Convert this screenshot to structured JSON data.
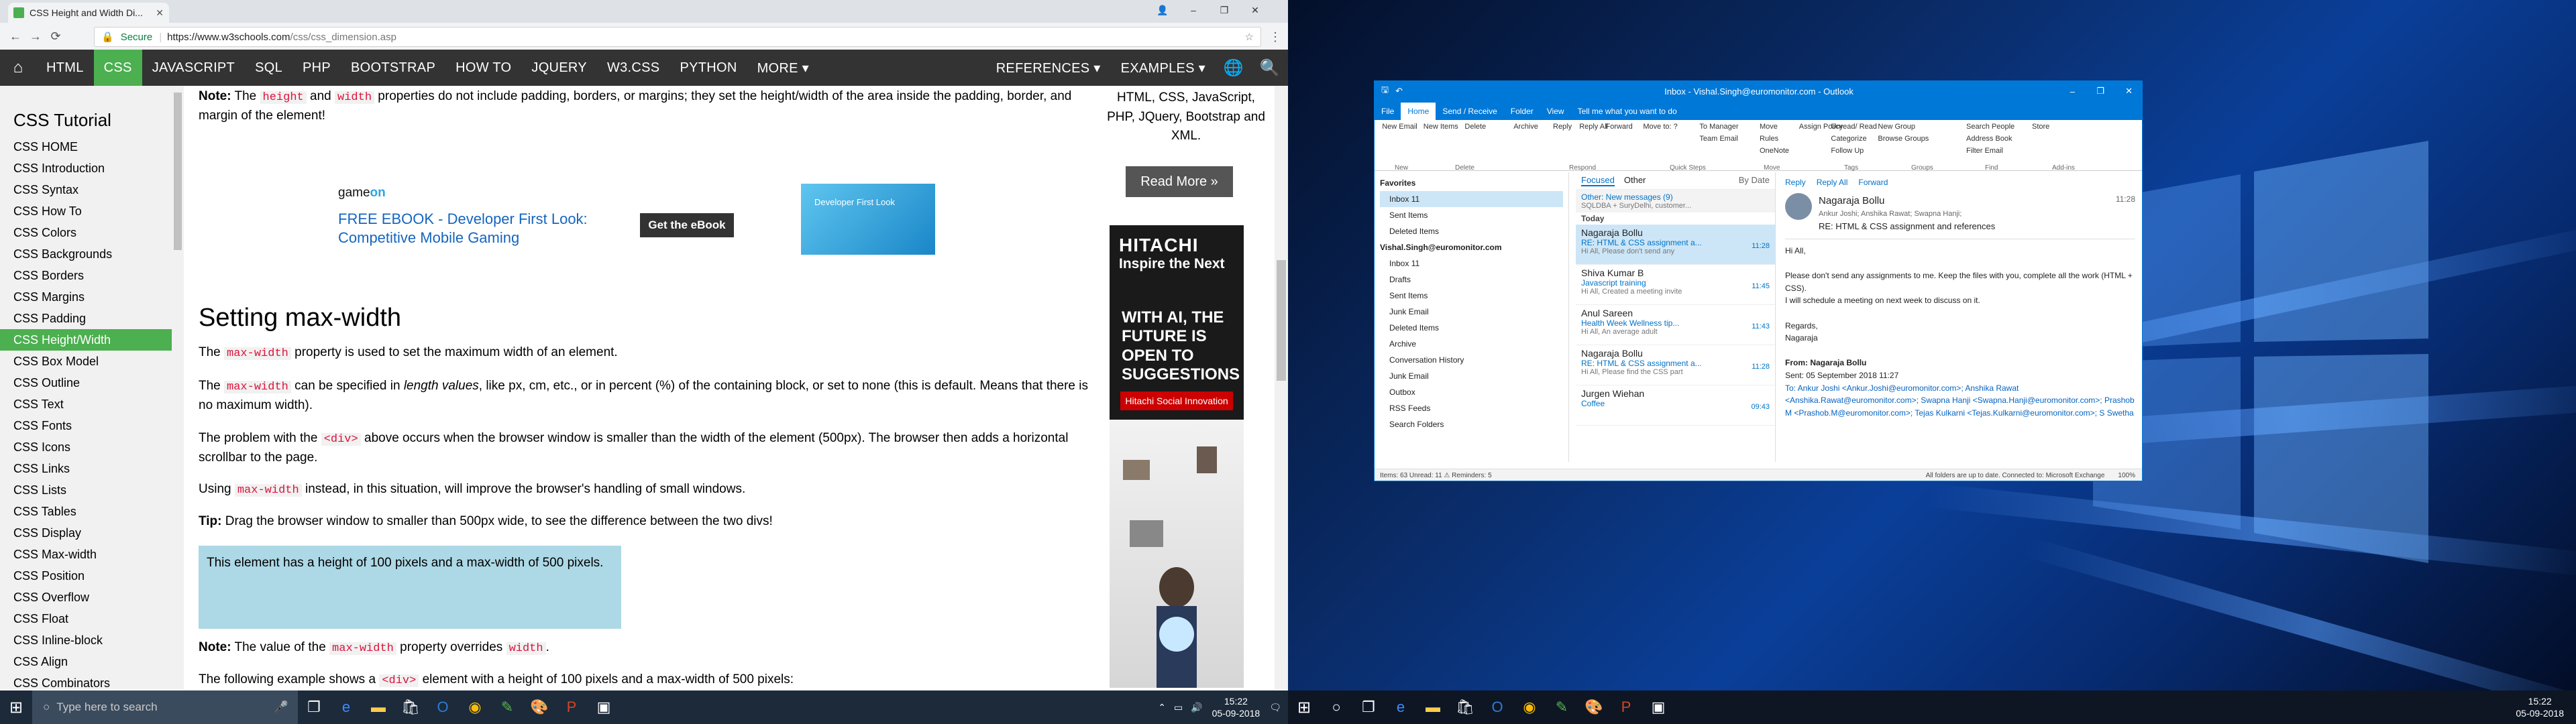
{
  "browser": {
    "tab_title": "CSS Height and Width Di...",
    "secure": "Secure",
    "url_host": "https://www.w3schools.com",
    "url_path": "/css/css_dimension.asp"
  },
  "nav": {
    "items": [
      "HTML",
      "CSS",
      "JAVASCRIPT",
      "SQL",
      "PHP",
      "BOOTSTRAP",
      "HOW TO",
      "JQUERY",
      "W3.CSS",
      "PYTHON",
      "MORE ▾",
      "REFERENCES ▾",
      "EXAMPLES ▾"
    ]
  },
  "sidebar": {
    "title": "CSS Tutorial",
    "links": [
      "CSS HOME",
      "CSS Introduction",
      "CSS Syntax",
      "CSS How To",
      "CSS Colors",
      "CSS Backgrounds",
      "CSS Borders",
      "CSS Margins",
      "CSS Padding",
      "CSS Height/Width",
      "CSS Box Model",
      "CSS Outline",
      "CSS Text",
      "CSS Fonts",
      "CSS Icons",
      "CSS Links",
      "CSS Lists",
      "CSS Tables",
      "CSS Display",
      "CSS Max-width",
      "CSS Position",
      "CSS Overflow",
      "CSS Float",
      "CSS Inline-block",
      "CSS Align",
      "CSS Combinators"
    ]
  },
  "main": {
    "note_pre": "Note:",
    "note_text1": " The ",
    "note_code1": "height",
    "note_and": " and ",
    "note_code2": "width",
    "note_text2": " properties do not include padding, borders, or margins; they set the height/width of the area inside the padding, border, and margin of the element!",
    "ad_logo_a": "game",
    "ad_logo_b": "on",
    "ad_line1": "FREE EBOOK - Developer First Look:",
    "ad_line2": "Competitive Mobile Gaming",
    "ad_button": "Get the eBook",
    "ad_book": "Developer First Look",
    "heading": "Setting max-width",
    "p1_a": "The ",
    "p1_code": "max-width",
    "p1_b": " property is used to set the maximum width of an element.",
    "p2_a": "The ",
    "p2_code": "max-width",
    "p2_b": " can be specified in ",
    "p2_i": "length values",
    "p2_c": ", like px, cm, etc., or in percent (%) of the containing block, or set to none (this is default. Means that there is no maximum width).",
    "p3_a": "The problem with the ",
    "p3_code": "<div>",
    "p3_b": " above occurs when the browser window is smaller than the width of the element (500px). The browser then adds a horizontal scrollbar to the page.",
    "p4_a": "Using ",
    "p4_code": "max-width",
    "p4_b": " instead, in this situation, will improve the browser's handling of small windows.",
    "tip_b": "Tip:",
    "tip_t": " Drag the browser window to smaller than 500px wide, to see the difference between the two divs!",
    "demo": "This element has a height of 100 pixels and a max-width of 500 pixels.",
    "note2_b": "Note:",
    "note2_a": " The value of the ",
    "note2_code1": "max-width",
    "note2_c": " property overrides ",
    "note2_code2": "width",
    "note2_d": ".",
    "last_a": "The following example shows a ",
    "last_code": "<div>",
    "last_b": " element with a height of 100 pixels and a max-width of 500 pixels:"
  },
  "right": {
    "text": "HTML, CSS, JavaScript, PHP, JQuery, Bootstrap and XML.",
    "read_more": "Read More »",
    "hitachi_brand": "HITACHI",
    "hitachi_tag": "Inspire the Next",
    "hitachi_big": "WITH AI, THE FUTURE IS OPEN TO SUGGESTIONS",
    "hitachi_pill": "Hitachi Social Innovation"
  },
  "taskbar1": {
    "search": "Type here to search",
    "time": "15:22",
    "date": "05-09-2018"
  },
  "taskbar2": {
    "time": "15:22",
    "date": "05-09-2018"
  },
  "outlook": {
    "title": "Inbox - Vishal.Singh@euromonitor.com - Outlook",
    "menu": [
      "File",
      "Home",
      "Send / Receive",
      "Folder",
      "View",
      "Tell me what you want to do"
    ],
    "ribbon": [
      "New Email",
      "New Items",
      "Delete",
      "Archive",
      "Reply",
      "Reply All",
      "Forward",
      "Move to: ?",
      "To Manager",
      "Team Email",
      "Move",
      "Rules",
      "OneNote",
      "Assign Policy",
      "Unread/ Read",
      "Categorize",
      "Follow Up",
      "New Group",
      "Browse Groups",
      "Search People",
      "Address Book",
      "Filter Email",
      "Store"
    ],
    "groups": [
      "New",
      "Delete",
      "Respond",
      "Quick Steps",
      "Move",
      "Tags",
      "Groups",
      "Find",
      "Add-ins"
    ],
    "folders": [
      "Favorites",
      "Inbox 11",
      "Sent Items",
      "Deleted Items",
      "Vishal.Singh@euromonitor.com",
      "Inbox 11",
      "Drafts",
      "Sent Items",
      "Junk Email",
      "Deleted Items",
      "Archive",
      "Conversation History",
      "Junk Email",
      "Outbox",
      "RSS Feeds",
      "Search Folders"
    ],
    "list_head": [
      "Focused",
      "Other",
      "By Date"
    ],
    "other": "Other: New messages (9)",
    "other_sub": "SQLDBA + SuryDelhi, customer...",
    "today": "Today",
    "mails": [
      {
        "name": "Nagaraja Bollu",
        "subj": "RE: HTML & CSS assignment a...",
        "prev": "Hi All,  Please don't send any",
        "time": "11:28"
      },
      {
        "name": "Shiva Kumar B",
        "subj": "Javascript training",
        "prev": "Hi All,  Created a meeting invite",
        "time": "11:45"
      },
      {
        "name": "Anul Sareen",
        "subj": "Health Week  Wellness tip...",
        "prev": "Hi All,  An average adult",
        "time": "11:43"
      },
      {
        "name": "Nagaraja Bollu",
        "subj": "RE: HTML & CSS assignment a...",
        "prev": "Hi All,  Please find the CSS part",
        "time": "11:28"
      },
      {
        "name": "Jurgen Wiehan",
        "subj": "Coffee",
        "prev": "",
        "time": "09:43"
      }
    ],
    "read": {
      "actions": [
        "Reply",
        "Reply All",
        "Forward"
      ],
      "from": "Nagaraja Bollu",
      "to": "Ankur Joshi; Anshika Rawat; Swapna Hanji;",
      "subject": "RE: HTML & CSS assignment and references",
      "time": "11:28",
      "greet": "Hi All,",
      "body1": "Please don't send any assignments to me. Keep the files with you, complete all the work (HTML + CSS).",
      "body2": "I will schedule a meeting on next week to discuss on it.",
      "regards": "Regards,",
      "sign": "Nagaraja",
      "f_from": "From: Nagaraja Bollu",
      "f_sent": "Sent: 05 September 2018 11:27",
      "f_to": "To: Ankur Joshi <Ankur.Joshi@euromonitor.com>; Anshika Rawat <Anshika.Rawat@euromonitor.com>; Swapna Hanji <Swapna.Hanji@euromonitor.com>; Prashob M <Prashob.M@euromonitor.com>; Tejas Kulkarni <Tejas.Kulkarni@euromonitor.com>; S Swetha"
    },
    "status": "Items: 63    Unread: 11    ⚠ Reminders: 5",
    "status_r": "All folders are up to date.    Connected to: Microsoft Exchange",
    "zoom": "100%"
  }
}
